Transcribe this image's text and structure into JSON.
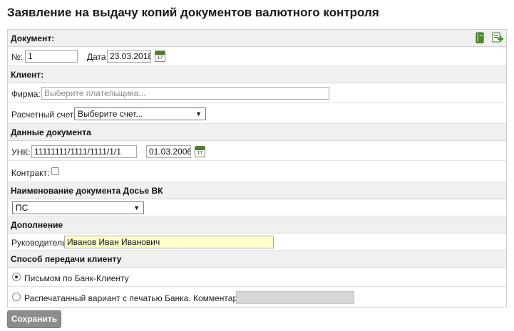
{
  "page": {
    "title": "Заявление на выдачу копий документов валютного контроля"
  },
  "sections": {
    "document": "Документ:",
    "client": "Клиент:",
    "doc_data": "Данные документа",
    "dossier": "Наименование документа Досье ВК",
    "addition": "Дополнение",
    "delivery": "Способ передачи клиенту"
  },
  "document": {
    "number_label": "№:",
    "number_value": "1",
    "date_label": "Дата",
    "date_value": "23.03.2018",
    "calendar_day": "17",
    "toolbar_icons": [
      "book-icon",
      "add-document-icon"
    ]
  },
  "client": {
    "firm_label": "Фирма:",
    "firm_placeholder": "Выберите плательщика...",
    "account_label": "Расчетный счет:",
    "account_selected": "Выберите счет..."
  },
  "doc_data": {
    "unk_label": "УНК:",
    "unk_value": "11111111/1111/1111/1/1",
    "unk_date": "01.03.2006",
    "calendar_day": "17",
    "contract_label": "Контракт:",
    "contract_checked": false
  },
  "dossier": {
    "selected": "ПС"
  },
  "addition": {
    "head_label": "Руководитель",
    "head_value": "Иванов Иван Иванович"
  },
  "delivery": {
    "option1": "Письмом по Банк-Клиенту",
    "option1_selected": true,
    "option2": "Распечатанный вариант с печатью Банка. Комментарий:",
    "option2_selected": false
  },
  "actions": {
    "save": "Сохранить"
  },
  "colors": {
    "accent_green": "#4e7a2f",
    "highlight_yellow": "#ffffcc",
    "button_grey": "#8d8d8d"
  }
}
